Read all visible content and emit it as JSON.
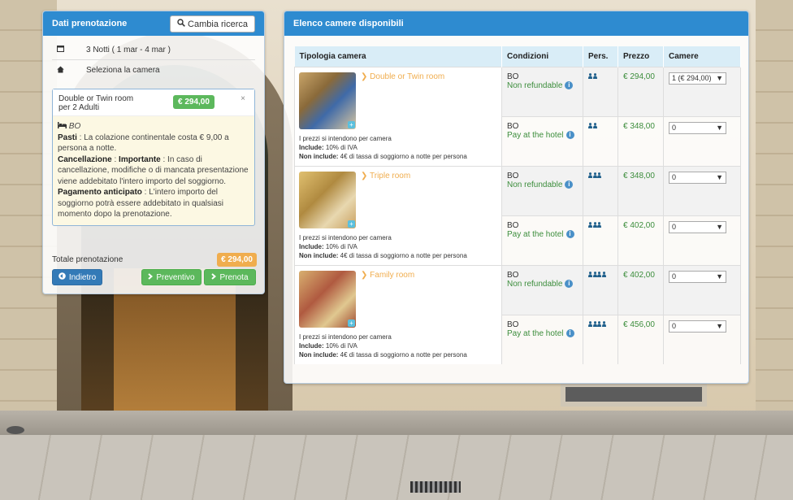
{
  "left_panel": {
    "title": "Dati prenotazione",
    "cambia_label": "Cambia ricerca",
    "nights": "3 Notti ( 1 mar - 4 mar )",
    "select_room": "Seleziona la camera",
    "room_box": {
      "room_name": "Double or Twin room",
      "guests": "per 2 Adulti",
      "price": "€ 294,00",
      "close": "×",
      "plan": "BO",
      "pasti_label": "Pasti",
      "pasti_text": " : La colazione continentale costa € 9,00 a persona a notte.",
      "canc_label": "Cancellazione",
      "canc_sep": " : ",
      "canc_imp": "Importante",
      "canc_text": " : In caso di cancellazione, modifiche o di mancata presentazione viene addebitato l'intero importo del soggiorno.",
      "pag_label": "Pagamento anticipato",
      "pag_text": " : L'intero importo del soggiorno potrà essere addebitato in qualsiasi momento dopo la prenotazione."
    },
    "totale_label": "Totale prenotazione",
    "totale_value": "€ 294,00",
    "indietro": "Indietro",
    "preventivo": "Preventivo",
    "prenota": "Prenota"
  },
  "right_panel": {
    "title": "Elenco camere disponibili",
    "headers": [
      "Tipologia camera",
      "Condizioni",
      "Pers.",
      "Prezzo",
      "Camere"
    ],
    "notes": {
      "line1": "I prezzi si intendono per camera",
      "include_label": "Include:",
      "include_text": " 10% di IVA",
      "non_include_label": "Non include:",
      "non_include_text": " 4€ di tassa di soggiorno a notte per persona"
    },
    "rooms": [
      {
        "name": "Double or Twin room",
        "rates": [
          {
            "plan": "BO",
            "condition": "Non refundable",
            "persons": "👥",
            "price": "€ 294,00",
            "selected": "1 (€ 294,00)"
          },
          {
            "plan": "BO",
            "condition": "Pay at the hotel",
            "persons": "👥",
            "price": "€ 348,00",
            "selected": "0"
          }
        ]
      },
      {
        "name": "Triple room",
        "rates": [
          {
            "plan": "BO",
            "condition": "Non refundable",
            "persons": "👥",
            "price": "€ 348,00",
            "selected": "0"
          },
          {
            "plan": "BO",
            "condition": "Pay at the hotel",
            "persons": "👥",
            "price": "€ 402,00",
            "selected": "0"
          }
        ]
      },
      {
        "name": "Family room",
        "rates": [
          {
            "plan": "BO",
            "condition": "Non refundable",
            "persons": "👥",
            "price": "€ 402,00",
            "selected": "0"
          },
          {
            "plan": "BO",
            "condition": "Pay at the hotel",
            "persons": "👥",
            "price": "€ 456,00",
            "selected": "0"
          }
        ]
      }
    ]
  },
  "colors": {
    "header_blue": "#2e8bd0",
    "green": "#5cb85c",
    "orange": "#f0ad4e",
    "table_head": "#d9edf7"
  }
}
